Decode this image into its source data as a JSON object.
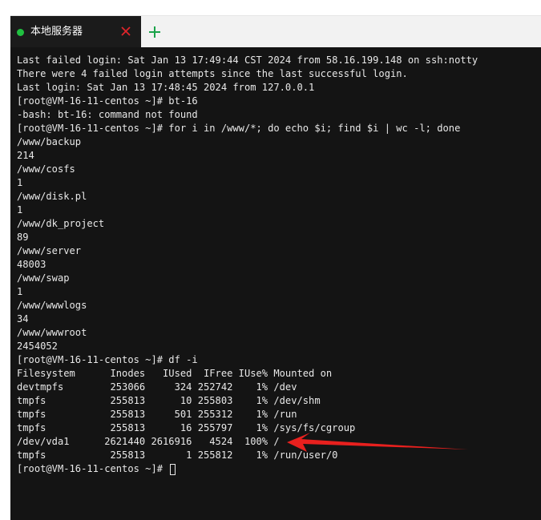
{
  "tabbar": {
    "active_tab": {
      "label": "本地服务器",
      "status_color": "#20c040",
      "close_icon": "close-icon",
      "close_color": "#e0252b"
    },
    "add_tab_icon": "plus-icon",
    "add_tab_color": "#1aa34a"
  },
  "terminal": {
    "lines": [
      "Last failed login: Sat Jan 13 17:49:44 CST 2024 from 58.16.199.148 on ssh:notty",
      "There were 4 failed login attempts since the last successful login.",
      "Last login: Sat Jan 13 17:48:45 2024 from 127.0.0.1",
      "[root@VM-16-11-centos ~]# bt-16",
      "-bash: bt-16: command not found",
      "[root@VM-16-11-centos ~]# for i in /www/*; do echo $i; find $i | wc -l; done",
      "/www/backup",
      "214",
      "/www/cosfs",
      "1",
      "/www/disk.pl",
      "1",
      "/www/dk_project",
      "89",
      "/www/server",
      "48003",
      "/www/swap",
      "1",
      "/www/wwwlogs",
      "34",
      "/www/wwwroot",
      "2454052",
      "[root@VM-16-11-centos ~]# df -i",
      "Filesystem      Inodes   IUsed  IFree IUse% Mounted on",
      "devtmpfs        253066     324 252742    1% /dev",
      "tmpfs           255813      10 255803    1% /dev/shm",
      "tmpfs           255813     501 255312    1% /run",
      "tmpfs           255813      16 255797    1% /sys/fs/cgroup",
      "/dev/vda1      2621440 2616916   4524  100% /",
      "tmpfs           255813       1 255812    1% /run/user/0"
    ],
    "prompt": "[root@VM-16-11-centos ~]# ",
    "text_color": "#e8e8e8",
    "background_color": "#141414"
  },
  "annotation": {
    "type": "red-arrow-pointing-left",
    "color": "#e8201e"
  }
}
